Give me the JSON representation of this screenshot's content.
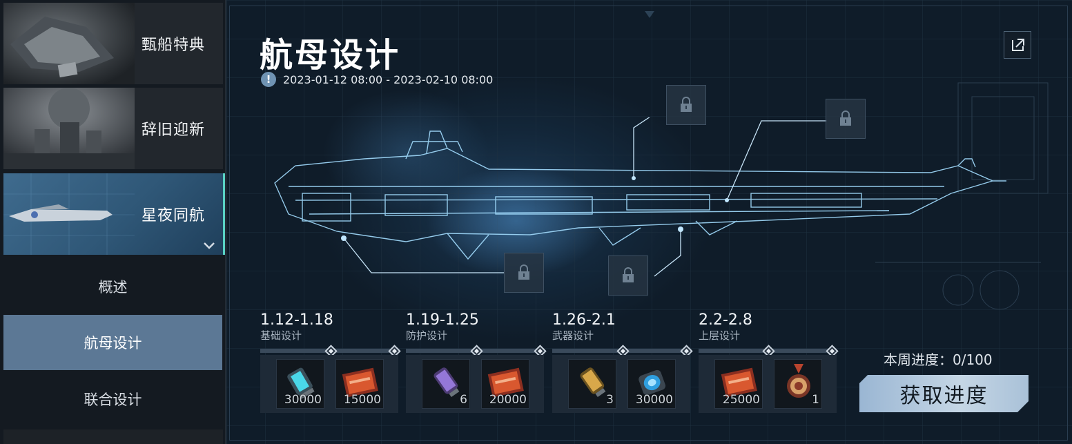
{
  "sidebar": {
    "events": [
      {
        "label": "甄船特典",
        "icon": "warship-thumbnail"
      },
      {
        "label": "辞旧迎新",
        "icon": "characters-thumbnail"
      },
      {
        "label": "星夜同航",
        "icon": "carrier-thumbnail"
      }
    ],
    "sub_items": [
      {
        "label": "概述"
      },
      {
        "label": "航母设计"
      },
      {
        "label": "联合设计"
      }
    ],
    "active_sub": "航母设计"
  },
  "main": {
    "title": "航母设计",
    "date_range": "2023-01-12 08:00 - 2023-02-10 08:00",
    "stages": [
      {
        "range": "1.12-1.18",
        "name": "基础设计",
        "rewards": [
          {
            "icon": "energy-cell-icon",
            "qty": "30000"
          },
          {
            "icon": "blueprint-card-icon",
            "qty": "15000"
          }
        ]
      },
      {
        "range": "1.19-1.25",
        "name": "防护设计",
        "rewards": [
          {
            "icon": "purple-module-icon",
            "qty": "6"
          },
          {
            "icon": "blueprint-card-icon",
            "qty": "20000"
          }
        ]
      },
      {
        "range": "1.26-2.1",
        "name": "武器设计",
        "rewards": [
          {
            "icon": "gold-module-icon",
            "qty": "3"
          },
          {
            "icon": "blue-cylinder-icon",
            "qty": "30000"
          }
        ]
      },
      {
        "range": "2.2-2.8",
        "name": "上层设计",
        "rewards": [
          {
            "icon": "blueprint-card-icon",
            "qty": "25000"
          },
          {
            "icon": "medal-icon",
            "qty": "1"
          }
        ]
      }
    ],
    "weekly_progress": "本周进度：0/100",
    "get_progress_label": "获取进度"
  },
  "colors": {
    "accent": "#59d1c4",
    "active_tab": "#5c7895",
    "button": "#b5cadf"
  }
}
